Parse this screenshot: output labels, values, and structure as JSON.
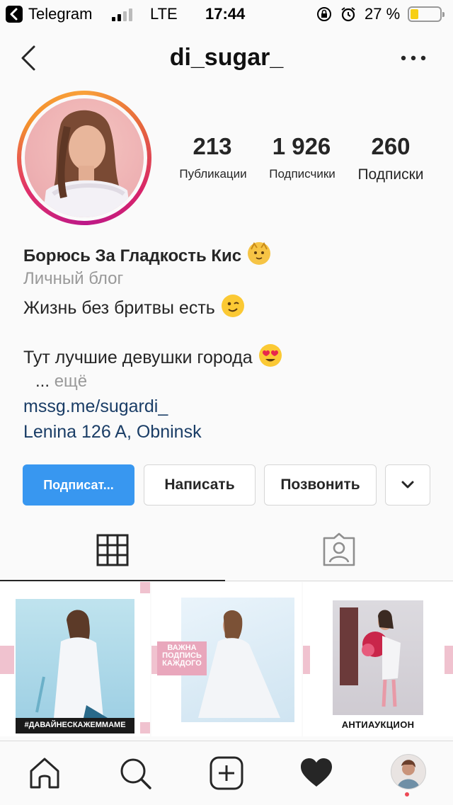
{
  "status_bar": {
    "back_app": "Telegram",
    "network": "LTE",
    "time": "17:44",
    "battery_percent": "27 %",
    "battery_level": 0.27,
    "icons": [
      "back-app-icon",
      "signal-icon",
      "orientation-lock-icon",
      "alarm-icon",
      "battery-icon"
    ]
  },
  "nav": {
    "title": "di_sugar_",
    "icons": [
      "back-icon",
      "more-icon"
    ]
  },
  "profile": {
    "stats": [
      {
        "value": "213",
        "label": "Публикации"
      },
      {
        "value": "1 926",
        "label": "Подписчики"
      },
      {
        "value": "260",
        "label": "Подписки"
      }
    ],
    "bio": {
      "name": "Борюсь За Гладкость Кис",
      "category": "Личный блог",
      "line1": "Жизнь без бритвы есть",
      "line2": "Тут лучшие девушки города",
      "more_prefix": "...",
      "more": "ещё",
      "link": "mssg.me/sugardi_",
      "address": "Lenina 126 A, Obninsk",
      "emojis": [
        "cat-emoji",
        "wink-emoji",
        "heart-eyes-emoji"
      ]
    }
  },
  "actions": {
    "follow": "Подписат...",
    "message": "Написать",
    "call": "Позвонить",
    "icons": [
      "chevron-down-icon"
    ]
  },
  "tabs": {
    "active": "grid",
    "icons": [
      "grid-icon",
      "tagged-icon"
    ]
  },
  "posts": [
    {
      "caption": "#ДАВАЙНЕСКАЖЕММАМЕ"
    },
    {
      "caption_lines": [
        "ВАЖНА",
        "ПОДПИСЬ",
        "КАЖДОГО"
      ]
    },
    {
      "caption": "АНТИАУКЦИОН"
    }
  ],
  "bottom_nav": {
    "icons": [
      "home-icon",
      "search-icon",
      "add-post-icon",
      "heart-icon",
      "profile-avatar-icon"
    ]
  },
  "colors": {
    "primary_button": "#3897f0",
    "link": "#1a3d66",
    "muted": "#999999",
    "accent_pink": "#f0c2cf",
    "notification_dot": "#ed4956"
  }
}
